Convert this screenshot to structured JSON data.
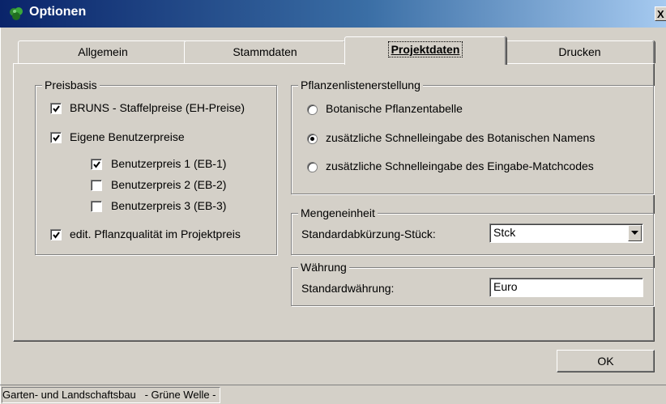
{
  "window": {
    "title": "Optionen",
    "icon": "plant-leaf-icon",
    "close_label": "X"
  },
  "tabs": [
    {
      "label": "Allgemein",
      "active": false
    },
    {
      "label": "Stammdaten",
      "active": false
    },
    {
      "label": "Projektdaten",
      "active": true
    },
    {
      "label": "Drucken",
      "active": false
    }
  ],
  "preisbasis": {
    "legend": "Preisbasis",
    "options": [
      {
        "label": "BRUNS - Staffelpreise (EH-Preise)",
        "checked": true
      },
      {
        "label": "Eigene Benutzerpreise",
        "checked": true
      },
      {
        "label": "Benutzerpreis 1 (EB-1)",
        "checked": true
      },
      {
        "label": "Benutzerpreis 2 (EB-2)",
        "checked": false
      },
      {
        "label": "Benutzerpreis 3 (EB-3)",
        "checked": false
      },
      {
        "label": "edit. Pflanzqualität im Projektpreis",
        "checked": true
      }
    ]
  },
  "pflanzenliste": {
    "legend": "Pflanzenlistenerstellung",
    "options": [
      {
        "label": "Botanische Pflanzentabelle",
        "selected": false
      },
      {
        "label": "zusätzliche Schnelleingabe des Botanischen Namens",
        "selected": true
      },
      {
        "label": "zusätzliche Schnelleingabe des Eingabe-Matchcodes",
        "selected": false
      }
    ]
  },
  "mengeneinheit": {
    "legend": "Mengeneinheit",
    "label": "Standardabkürzung-Stück:",
    "value": "Stck"
  },
  "waehrung": {
    "legend": "Währung",
    "label": "Standardwährung:",
    "value": "Euro"
  },
  "buttons": {
    "ok": "OK"
  },
  "status": {
    "text": "Garten- und Landschaftsbau   - Grüne Welle -"
  }
}
